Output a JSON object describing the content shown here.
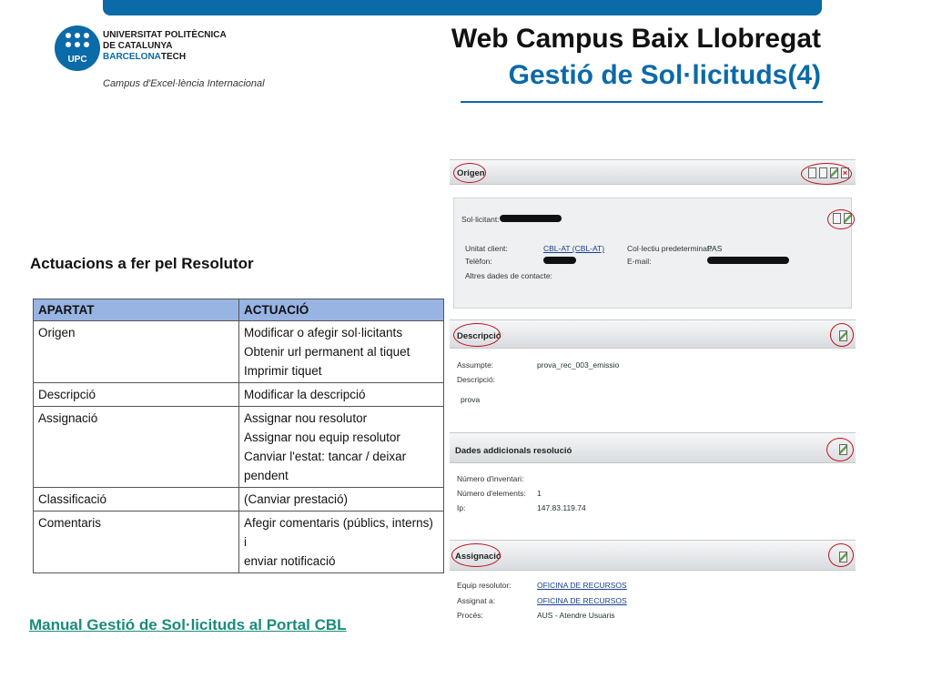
{
  "header": {
    "university_lines": [
      "UNIVERSITAT POLITÈCNICA",
      "DE CATALUNYA"
    ],
    "barcelona": "BARCELONA",
    "tech": "TECH",
    "logo_text": "UPC",
    "campus_tagline": "Campus d'Excel·lència Internacional",
    "title": "Web Campus Baix Llobregat",
    "subtitle": "Gestió de Sol·licituds(4)"
  },
  "section_label": "Actuacions a fer pel Resolutor",
  "table": {
    "headers": [
      "APARTAT",
      "ACTUACIÓ"
    ],
    "rows": [
      {
        "apartat": "Origen",
        "actuacio": [
          "Modificar o afegir sol·licitants",
          "Obtenir url permanent al tiquet",
          "Imprimir tiquet"
        ]
      },
      {
        "apartat": "Descripció",
        "actuacio": [
          "Modificar la descripció"
        ]
      },
      {
        "apartat": "Assignació",
        "actuacio": [
          "Assignar nou resolutor",
          "Assignar nou equip resolutor",
          "Canviar l'estat: tancar / deixar pendent"
        ]
      },
      {
        "apartat": "Classificació",
        "actuacio": [
          "(Canviar prestació)"
        ]
      },
      {
        "apartat": "Comentaris",
        "actuacio": [
          "Afegir comentaris  (públics, interns) i",
          "enviar notificació"
        ]
      }
    ]
  },
  "manual_link": "Manual Gestió de Sol·licituds al Portal CBL",
  "screenshot": {
    "origen": {
      "title": "Origen",
      "solicitant_label": "Sol·licitant:",
      "unitat_label": "Unitat client:",
      "unitat_value": "CBL-AT (CBL-AT)",
      "collectiu_label": "Col·lectiu predeterminat:",
      "collectiu_value": "PAS",
      "telefon_label": "Telèfon:",
      "email_label": "E-mail:",
      "altres_label": "Altres dades de contacte:"
    },
    "descripcio": {
      "title": "Descripció",
      "assumpte_label": "Assumpte:",
      "assumpte_value": "prova_rec_003_emissio",
      "descripcio_label": "Descripció:",
      "descripcio_value": "prova"
    },
    "dades": {
      "title": "Dades addicionals resolució",
      "inventari_label": "Número d'inventari:",
      "elements_label": "Número d'elements:",
      "elements_value": "1",
      "ip_label": "Ip:",
      "ip_value": "147.83.119.74"
    },
    "assignacio": {
      "title": "Assignació",
      "equip_label": "Equip resolutor:",
      "equip_value": "OFICINA DE RECURSOS",
      "assignat_label": "Assignat a:",
      "assignat_value": "OFICINA DE RECURSOS",
      "proces_label": "Procés:",
      "proces_value": "AUS - Atendre Usuaris"
    }
  },
  "colors": {
    "brand_blue": "#0b6aa8",
    "table_header": "#98b4e2",
    "link_green": "#1a8c7a",
    "annotation_red": "#c0121b"
  }
}
